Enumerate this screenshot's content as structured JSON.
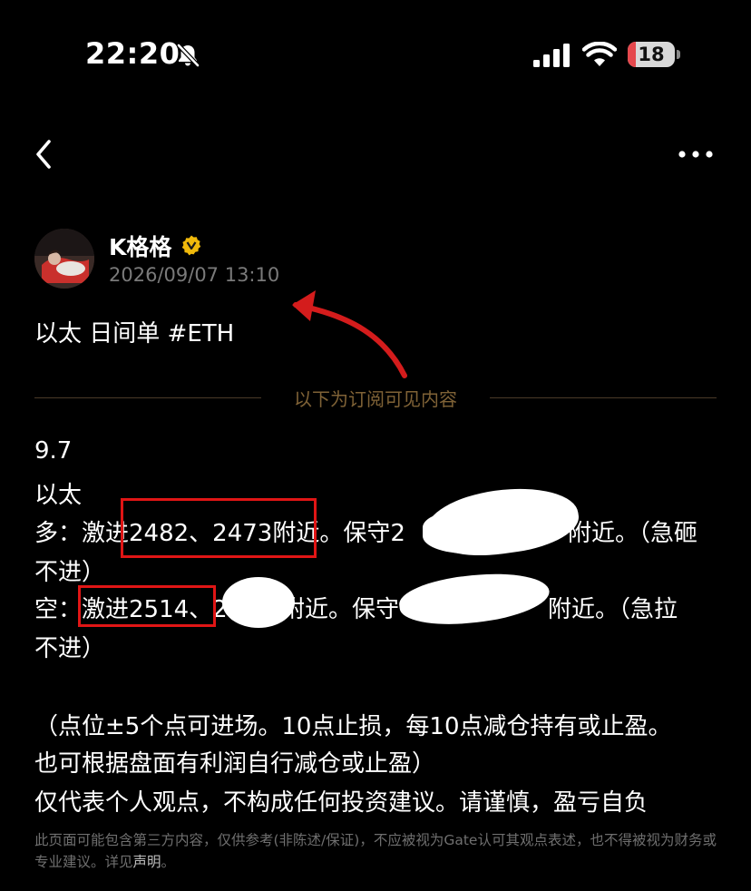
{
  "status_bar": {
    "time": "22:20",
    "battery": "18",
    "battery_level": 0.18
  },
  "post": {
    "author": "K格格",
    "timestamp": "2026/09/07 13:10",
    "title": "以太 日间单 #ETH",
    "divider_text": "以下为订阅可见内容",
    "lines": [
      "9.7",
      "以太",
      "多：激进2482、2473附近。保守2",
      "不进）",
      "空：激进2514、2",
      "不进）",
      "（点位±5个点可进场。10点止损，每10点减仓持有或止盈。",
      "也可根据盘面有利润自行减仓或止盈）",
      "仅代表个人观点，不构成任何投资建议。请谨慎，盈亏自负"
    ],
    "line3_tail": "附近。（急砸",
    "line5_mid": "附近。保守",
    "line5_tail": "附近。（急拉"
  },
  "disclaimer": {
    "text": "此页面可能包含第三方内容，仅供参考(非陈述/保证)，不应被视为Gate认可其观点表述，也不得被视为财务或专业建议。详见",
    "link": "声明",
    "end": "。"
  },
  "colors": {
    "background": "#000000",
    "accent_gold": "#7f6236",
    "annotation_red": "#e01515",
    "verified": "#f0b90b"
  },
  "icons": [
    "bell-slash-icon",
    "cellular-signal-icon",
    "wifi-icon",
    "battery-icon",
    "back-chevron-icon",
    "more-dots-icon",
    "verified-badge-icon"
  ]
}
